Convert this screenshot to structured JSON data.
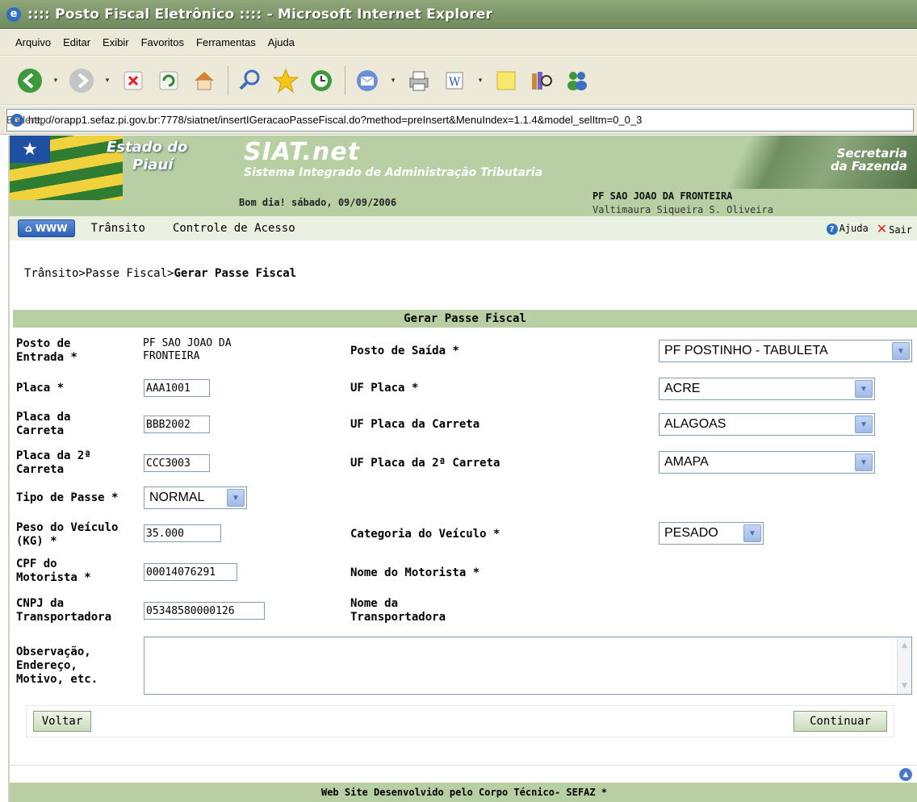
{
  "window": {
    "title": ":::: Posto Fiscal Eletrônico :::: - Microsoft Internet Explorer"
  },
  "menu": [
    "Arquivo",
    "Editar",
    "Exibir",
    "Favoritos",
    "Ferramentas",
    "Ajuda"
  ],
  "toolbar_icons": [
    "back-icon",
    "forward-icon",
    "stop-icon",
    "refresh-icon",
    "home-icon",
    "search-icon",
    "favorites-icon",
    "history-icon",
    "mail-icon",
    "print-icon",
    "edit-icon",
    "note-icon",
    "research-icon",
    "messenger-icon"
  ],
  "address": {
    "label": "Endereço",
    "url": "http://orapp1.sefaz.pi.gov.br:7778/siatnet/insertIGeracaoPasseFiscal.do?method=preInsert&MenuIndex=1.1.4&model_selItm=0_0_3"
  },
  "header": {
    "estado_l1": "Estado do",
    "estado_l2": "Piauí",
    "siat_title": "SIAT.net",
    "siat_subtitle": "Sistema Integrado de Administração Tributaria",
    "secretaria_l1": "Secretaria",
    "secretaria_l2": "da Fazenda",
    "greeting": "Bom dia! sábado, 09/09/2006",
    "posto": "PF SAO JOAO DA FRONTEIRA",
    "user": "Valtimaura Siqueira S. Oliveira"
  },
  "nav": {
    "www": "WWW",
    "links": [
      "Trânsito",
      "Controle de Acesso"
    ],
    "help": "Ajuda",
    "exit": "Sair"
  },
  "breadcrumb": {
    "part1": "Trânsito>Passe Fiscal>",
    "current": "Gerar Passe Fiscal"
  },
  "form": {
    "title": "Gerar Passe Fiscal",
    "posto_entrada": {
      "label_l1": "Posto de",
      "label_l2": "Entrada *",
      "value_l1": "PF SAO JOAO DA",
      "value_l2": "FRONTEIRA"
    },
    "posto_saida": {
      "label": "Posto de Saída *",
      "value": "PF POSTINHO - TABULETA"
    },
    "placa": {
      "label": "Placa *",
      "value": "AAA1001"
    },
    "uf_placa": {
      "label": "UF Placa *",
      "value": "ACRE"
    },
    "placa_carreta": {
      "label_l1": "Placa da",
      "label_l2": "Carreta",
      "value": "BBB2002"
    },
    "uf_placa_carreta": {
      "label": "UF Placa da Carreta",
      "value": "ALAGOAS"
    },
    "placa_2_carreta": {
      "label_l1": "Placa da 2ª",
      "label_l2": "Carreta",
      "value": "CCC3003"
    },
    "uf_placa_2_carreta": {
      "label": "UF Placa da 2ª Carreta",
      "value": "AMAPA"
    },
    "tipo_passe": {
      "label": "Tipo de Passe *",
      "value": "NORMAL"
    },
    "peso": {
      "label_l1": "Peso do Veículo",
      "label_l2": "(KG) *",
      "value": "35.000"
    },
    "categoria": {
      "label": "Categoria do Veículo *",
      "value": "PESADO"
    },
    "cpf": {
      "label_l1": "CPF do",
      "label_l2": "Motorista *",
      "value": "00014076291"
    },
    "nome_motorista": {
      "label": "Nome do Motorista *"
    },
    "cnpj": {
      "label_l1": "CNPJ da",
      "label_l2": "Transportadora",
      "value": "05348580000126"
    },
    "nome_transportadora": {
      "label_l1": "Nome da",
      "label_l2": "Transportadora"
    },
    "observacao": {
      "label_l1": "Observação,",
      "label_l2": "Endereço,",
      "label_l3": "Motivo, etc.",
      "value": ""
    },
    "back_button": "Voltar",
    "continue_button": "Continuar"
  },
  "footer": "Web Site Desenvolvido pelo Corpo Técnico- SEFAZ *"
}
